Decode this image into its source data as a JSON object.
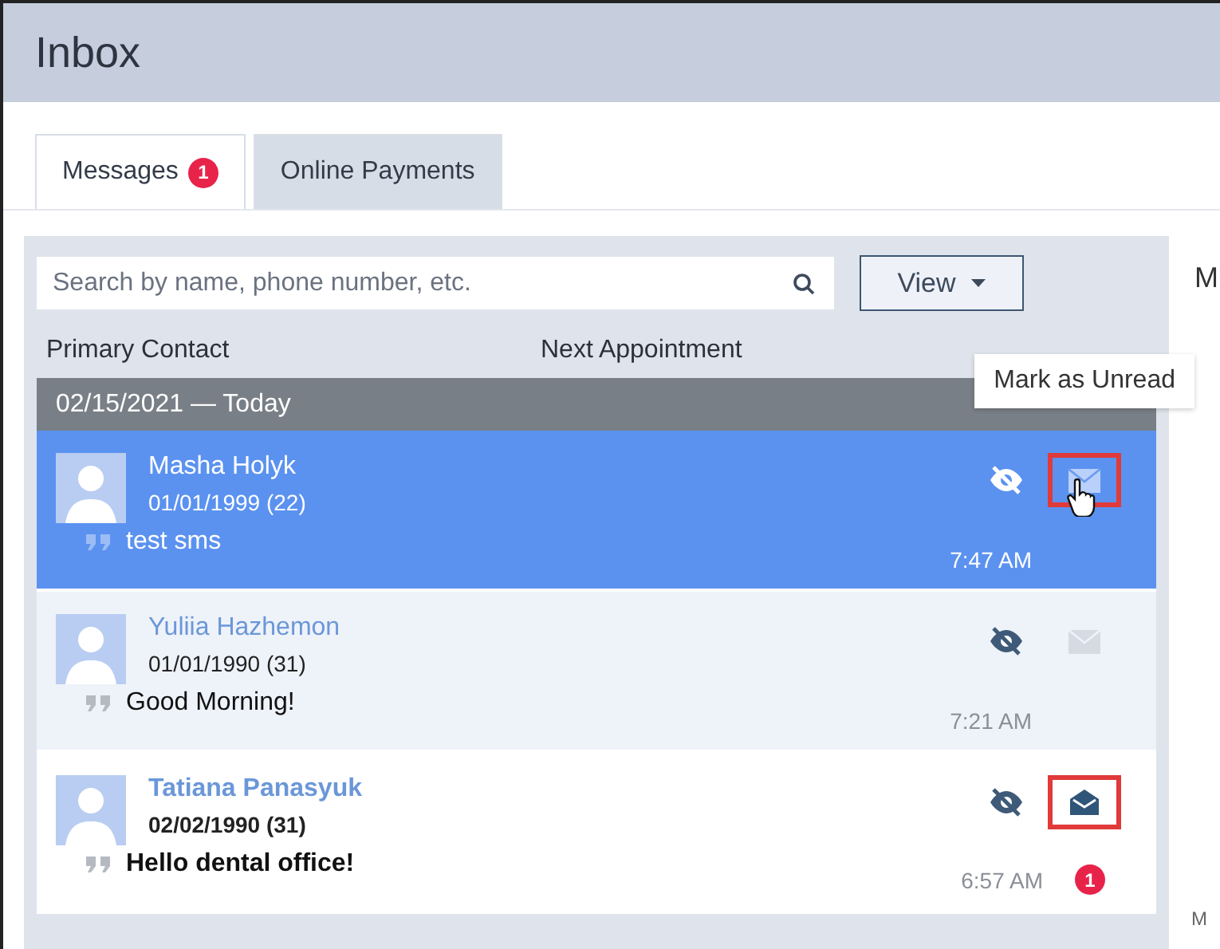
{
  "window": {
    "title": "Inbox"
  },
  "tabs": [
    {
      "label": "Messages",
      "badge": "1",
      "selected": true
    },
    {
      "label": "Online Payments",
      "selected": false
    }
  ],
  "search": {
    "placeholder": "Search by name, phone number, etc."
  },
  "view_button": {
    "label": "View"
  },
  "columns": [
    "Primary Contact",
    "Next Appointment"
  ],
  "group": {
    "label": "02/15/2021 — Today"
  },
  "tooltip": {
    "text": "Mark as Unread"
  },
  "messages": [
    {
      "name": "Masha Holyk",
      "dob": "01/01/1999 (22)",
      "text": "test sms",
      "time": "7:47 AM",
      "selected": true,
      "unread": false,
      "highlighted": true
    },
    {
      "name": "Yuliia Hazhemon",
      "dob": "01/01/1990 (31)",
      "text": "Good Morning!",
      "time": "7:21 AM",
      "selected": false,
      "unread": false,
      "highlighted": false
    },
    {
      "name": "Tatiana Panasyuk",
      "dob": "02/02/1990 (31)",
      "text": "Hello dental office!",
      "time": "6:57 AM",
      "selected": false,
      "unread": true,
      "highlighted": true,
      "badge": "1"
    }
  ],
  "right_panel": {
    "heading": "M",
    "footer": "M"
  }
}
